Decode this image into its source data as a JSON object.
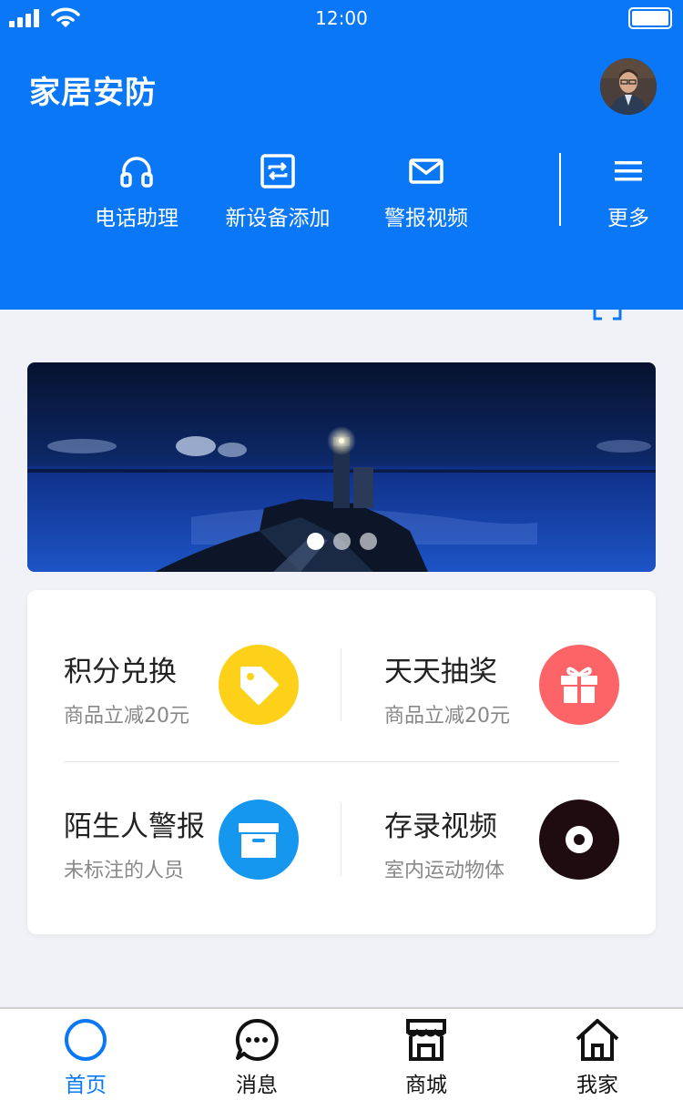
{
  "status_bar": {
    "time": "12:00"
  },
  "header": {
    "title": "家居安防"
  },
  "quick_actions": [
    {
      "label": "电话助理",
      "icon": "headset-icon"
    },
    {
      "label": "新设备添加",
      "icon": "sync-icon"
    },
    {
      "label": "警报视频",
      "icon": "mail-icon"
    },
    {
      "label": "更多",
      "icon": "menu-icon"
    }
  ],
  "banner": {
    "slide_count": 3,
    "active_index": 0
  },
  "features": [
    {
      "title": "积分兑换",
      "subtitle": "商品立减20元",
      "icon": "tag-icon",
      "color": "#fdd11a"
    },
    {
      "title": "天天抽奖",
      "subtitle": "商品立减20元",
      "icon": "gift-icon",
      "color": "#fc6468"
    },
    {
      "title": "陌生人警报",
      "subtitle": "未标注的人员",
      "icon": "archive-box-icon",
      "color": "#1697ef"
    },
    {
      "title": "存录视频",
      "subtitle": "室内运动物体",
      "icon": "vinyl-disc-icon",
      "color": "#1f0c11"
    }
  ],
  "tabs": [
    {
      "label": "首页",
      "icon": "home-circle-icon",
      "active": true
    },
    {
      "label": "消息",
      "icon": "chat-bubble-icon",
      "active": false
    },
    {
      "label": "商城",
      "icon": "store-icon",
      "active": false
    },
    {
      "label": "我家",
      "icon": "house-icon",
      "active": false
    }
  ],
  "colors": {
    "primary": "#0a78f6",
    "background": "#f0f2f7"
  }
}
